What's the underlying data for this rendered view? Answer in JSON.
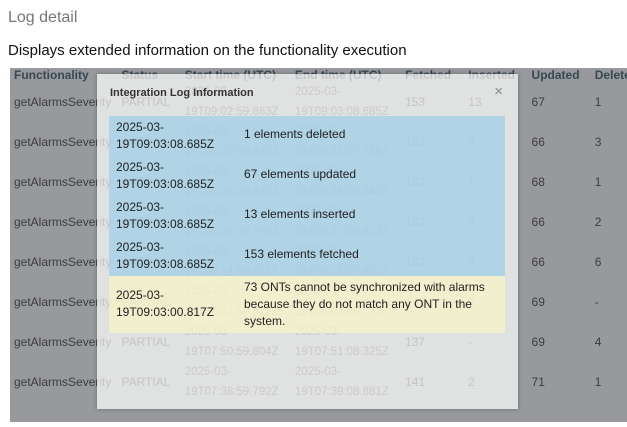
{
  "page": {
    "title": "Log detail",
    "subtitle": "Displays extended information on the functionality execution"
  },
  "table": {
    "columns": [
      "Functionality",
      "Status",
      "Start time (UTC)",
      "End time (UTC)",
      "Fetched",
      "Inserted",
      "Updated",
      "Deleted"
    ],
    "rows": [
      {
        "functionality": "getAlarmsSeverity",
        "status": "PARTIAL",
        "start": "2025-03-19T09:02:59.863Z",
        "end": "2025-03-19T09:03:08.685Z",
        "fetched": "153",
        "inserted": "13",
        "updated": "67",
        "deleted": "1"
      },
      {
        "functionality": "getAlarmsSeverity",
        "status": "PARTIAL",
        "start": "2025-03-19T08:50:59.833Z",
        "end": "2025-03-19T08:51:07.758Z",
        "fetched": "133",
        "inserted": "2",
        "updated": "66",
        "deleted": "3"
      },
      {
        "functionality": "getAlarmsSeverity",
        "status": "PARTIAL",
        "start": "2025-03-19T08:38:59.833Z",
        "end": "2025-03-19T08:39:08.540Z",
        "fetched": "132",
        "inserted": "1",
        "updated": "68",
        "deleted": "1"
      },
      {
        "functionality": "getAlarmsSeverity",
        "status": "PARTIAL",
        "start": "2025-03-19T08:26:59.798Z",
        "end": "2025-03-19T08:27:05.822Z",
        "fetched": "132",
        "inserted": "3",
        "updated": "66",
        "deleted": "2"
      },
      {
        "functionality": "getAlarmsSeverity",
        "status": "PARTIAL",
        "start": "2025-03-19T08:14:59.811Z",
        "end": "2025-03-19T08:15:07.931Z",
        "fetched": "132",
        "inserted": "2",
        "updated": "66",
        "deleted": "6"
      },
      {
        "functionality": "getAlarmsSeverity",
        "status": "PARTIAL",
        "start": "2025-03-19T08:02:59.813Z",
        "end": "2025-03-19T08:03:05.778Z",
        "fetched": "141",
        "inserted": "3",
        "updated": "69",
        "deleted": "-"
      },
      {
        "functionality": "getAlarmsSeverity",
        "status": "PARTIAL",
        "start": "2025-03-19T07:50:59.804Z",
        "end": "2025-03-19T07:51:08.325Z",
        "fetched": "137",
        "inserted": "-",
        "updated": "69",
        "deleted": "4"
      },
      {
        "functionality": "getAlarmsSeverity",
        "status": "PARTIAL",
        "start": "2025-03-19T07:38:59.792Z",
        "end": "2025-03-19T07:39:08.881Z",
        "fetched": "141",
        "inserted": "2",
        "updated": "71",
        "deleted": "1"
      }
    ]
  },
  "modal": {
    "title": "Integration Log Information",
    "close_label": "×",
    "entries": [
      {
        "time": "2025-03-19T09:03:08.685Z",
        "message": "1 elements deleted",
        "level": "info"
      },
      {
        "time": "2025-03-19T09:03:08.685Z",
        "message": "67 elements updated",
        "level": "info"
      },
      {
        "time": "2025-03-19T09:03:08.685Z",
        "message": "13 elements inserted",
        "level": "info"
      },
      {
        "time": "2025-03-19T09:03:08.685Z",
        "message": "153 elements fetched",
        "level": "info"
      },
      {
        "time": "2025-03-19T09:03:00.817Z",
        "message": "73 ONTs cannot be synchronized with alarms because they do not match any ONT in the system.",
        "level": "warning"
      }
    ]
  }
}
